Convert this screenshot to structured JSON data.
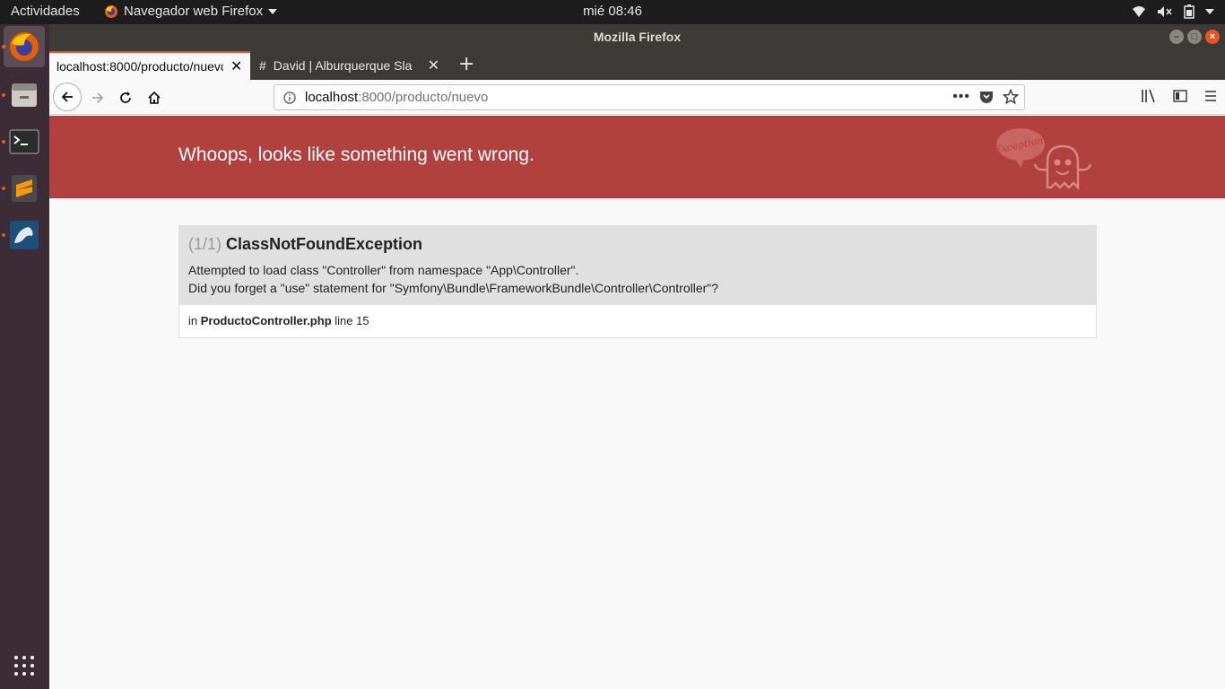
{
  "topbar": {
    "activities": "Actividades",
    "app_menu": "Navegador web Firefox",
    "clock": "mié 08:46"
  },
  "dock": {
    "items": [
      "firefox-icon",
      "files-icon",
      "terminal-icon",
      "sublime-text-icon",
      "mysql-workbench-icon",
      "show-apps-icon"
    ]
  },
  "window": {
    "title": "Mozilla Firefox"
  },
  "tabs": [
    {
      "title": "localhost:8000/producto/nuevo",
      "selected": true
    },
    {
      "title": "David | Alburquerque Sla",
      "selected": false
    }
  ],
  "urlbar": {
    "host": "localhost",
    "path": ":8000/producto/nuevo"
  },
  "page": {
    "header": "Whoops, looks like something went wrong.",
    "ghost_label": "Exception!",
    "exception": {
      "count": "(1/1)",
      "class": "ClassNotFoundException",
      "line1": "Attempted to load class \"Controller\" from namespace \"App\\Controller\".",
      "line2": "Did you forget a \"use\" statement for \"Symfony\\Bundle\\FrameworkBundle\\Controller\\Controller\"?",
      "trace_in": "in",
      "trace_file": "ProductoController.php",
      "trace_line": "line 15"
    }
  },
  "colors": {
    "header_bg": "#b0413e",
    "ubuntu_orange": "#e95420",
    "dock_bg": "#3b2c36"
  }
}
